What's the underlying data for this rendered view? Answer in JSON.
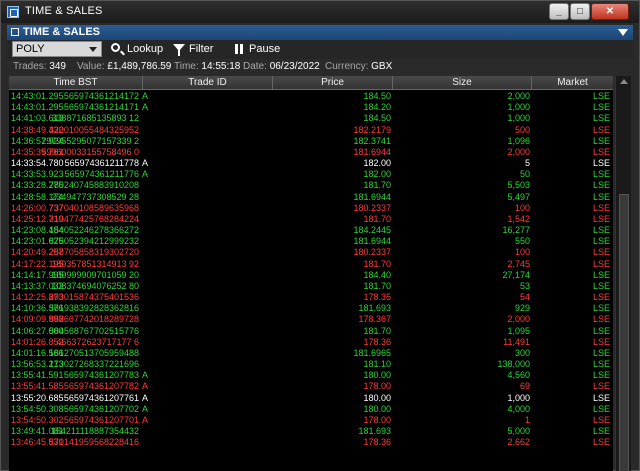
{
  "window": {
    "title": "TIME & SALES"
  },
  "panel": {
    "title": "TIME & SALES"
  },
  "toolbar": {
    "symbol": "POLY",
    "lookup_label": "Lookup",
    "filter_label": "Filter",
    "pause_label": "Pause"
  },
  "info": {
    "trades_label": "Trades:",
    "trades_value": "349",
    "value_label": "Value:",
    "value_value": "£1,489,786.59",
    "time_label": "Time:",
    "time_value": "14:55:18",
    "date_label": "Date:",
    "date_value": "06/23/2022",
    "currency_label": "Currency:",
    "currency_value": "GBX"
  },
  "columns": [
    "Time BST",
    "Trade ID",
    "Price",
    "Size",
    "Market"
  ],
  "rows": [
    {
      "time": "14:43:01.295",
      "id": "565974361214172",
      "flag": "A",
      "price": "184.50",
      "size": "2,000",
      "market": "LSE",
      "color": "green"
    },
    {
      "time": "14:43:01.295",
      "id": "565974361214171",
      "flag": "A",
      "price": "184.20",
      "size": "1,000",
      "market": "LSE",
      "color": "green"
    },
    {
      "time": "14:41:03.613",
      "id": "338871685135893 12",
      "flag": "",
      "price": "184.50",
      "size": "1,000",
      "market": "LSE",
      "color": "green"
    },
    {
      "time": "14:38:49.432",
      "id": "320010055484325952",
      "flag": "",
      "price": "182.2179",
      "size": "500",
      "market": "LSE",
      "color": "red"
    },
    {
      "time": "14:36:57.924",
      "id": "297955295077157339 2",
      "flag": "",
      "price": "182.3741",
      "size": "1,096",
      "market": "LSE",
      "color": "green"
    },
    {
      "time": "14:35:39.761",
      "id": "599600033155758496 0",
      "flag": "",
      "price": "181.6944",
      "size": "2,000",
      "market": "LSE",
      "color": "red"
    },
    {
      "time": "14:33:54.780",
      "id": "565974361211778",
      "flag": "A",
      "price": "182.00",
      "size": "5",
      "market": "LSE",
      "color": "white"
    },
    {
      "time": "14:33:53.923",
      "id": "565974361211776",
      "flag": "A",
      "price": "182.00",
      "size": "50",
      "market": "LSE",
      "color": "green"
    },
    {
      "time": "14:33:28.275",
      "id": "780240745883910208",
      "flag": "",
      "price": "181.70",
      "size": "5,503",
      "market": "LSE",
      "color": "green"
    },
    {
      "time": "14:28:58.174",
      "id": "234947737308529 28",
      "flag": "",
      "price": "181.6944",
      "size": "5,497",
      "market": "LSE",
      "color": "green"
    },
    {
      "time": "14:26:00.737",
      "id": "737040108589635968",
      "flag": "",
      "price": "180.2337",
      "size": "100",
      "market": "LSE",
      "color": "red"
    },
    {
      "time": "14:25:12.719",
      "id": "310477425768284224",
      "flag": "",
      "price": "181.70",
      "size": "1,542",
      "market": "LSE",
      "color": "red"
    },
    {
      "time": "14:23:08.484",
      "id": "154052246278366272",
      "flag": "",
      "price": "184.2445",
      "size": "16,277",
      "market": "LSE",
      "color": "green"
    },
    {
      "time": "14:23:01.625",
      "id": "876052394212999232",
      "flag": "",
      "price": "181.6944",
      "size": "550",
      "market": "LSE",
      "color": "green"
    },
    {
      "time": "14:20:49.257",
      "id": "288705858319302720",
      "flag": "",
      "price": "180.2337",
      "size": "100",
      "market": "LSE",
      "color": "red"
    },
    {
      "time": "14:17:22.195",
      "id": "189357851314913 92",
      "flag": "",
      "price": "181.70",
      "size": "2,745",
      "market": "LSE",
      "color": "red"
    },
    {
      "time": "14:14:17.995",
      "id": "109999909701059 20",
      "flag": "",
      "price": "184.40",
      "size": "27,174",
      "market": "LSE",
      "color": "green"
    },
    {
      "time": "14:13:37.032",
      "id": "108374694076252 80",
      "flag": "",
      "price": "181.70",
      "size": "53",
      "market": "LSE",
      "color": "green"
    },
    {
      "time": "14:12:25.873",
      "id": "293015874375401536",
      "flag": "",
      "price": "178.35",
      "size": "54",
      "market": "LSE",
      "color": "red"
    },
    {
      "time": "14:10:36.376",
      "id": "581938392828362816",
      "flag": "",
      "price": "181.693",
      "size": "929",
      "market": "LSE",
      "color": "green"
    },
    {
      "time": "14:09:09.998",
      "id": "882667742018289728",
      "flag": "",
      "price": "178.367",
      "size": "2,000",
      "market": "LSE",
      "color": "red"
    },
    {
      "time": "14:06:27.000",
      "id": "584568767702515776",
      "flag": "",
      "price": "181.70",
      "size": "1,095",
      "market": "LSE",
      "color": "green"
    },
    {
      "time": "14:01:26.852",
      "id": "466372623717177 6",
      "flag": "",
      "price": "178.36",
      "size": "11,491",
      "market": "LSE",
      "color": "red"
    },
    {
      "time": "14:01:16.566",
      "id": "181270513705959488",
      "flag": "",
      "price": "181.6965",
      "size": "300",
      "market": "LSE",
      "color": "green"
    },
    {
      "time": "13:56:53.213",
      "id": "173027268337221696",
      "flag": "",
      "price": "181.10",
      "size": "138,000",
      "market": "LSE",
      "color": "green"
    },
    {
      "time": "13:55:41.591",
      "id": "565974361207783",
      "flag": "A",
      "price": "180.00",
      "size": "4,560",
      "market": "LSE",
      "color": "green"
    },
    {
      "time": "13:55:41.585",
      "id": "565974361207782",
      "flag": "A",
      "price": "178.00",
      "size": "69",
      "market": "LSE",
      "color": "red"
    },
    {
      "time": "13:55:20.685",
      "id": "565974361207761",
      "flag": "A",
      "price": "180.00",
      "size": "1,000",
      "market": "LSE",
      "color": "white"
    },
    {
      "time": "13:54:50.308",
      "id": "565974361207702",
      "flag": "A",
      "price": "180.00",
      "size": "4,000",
      "market": "LSE",
      "color": "green"
    },
    {
      "time": "13:54:50.302",
      "id": "565974361207701",
      "flag": "A",
      "price": "178.00",
      "size": "1",
      "market": "LSE",
      "color": "red"
    },
    {
      "time": "13:49:41.081",
      "id": "154211118887354432",
      "flag": "",
      "price": "181.693",
      "size": "5,000",
      "market": "LSE",
      "color": "green"
    },
    {
      "time": "13:46:45.531",
      "id": "870141959568228416",
      "flag": "",
      "price": "178.36",
      "size": "2,662",
      "market": "LSE",
      "color": "red"
    }
  ]
}
